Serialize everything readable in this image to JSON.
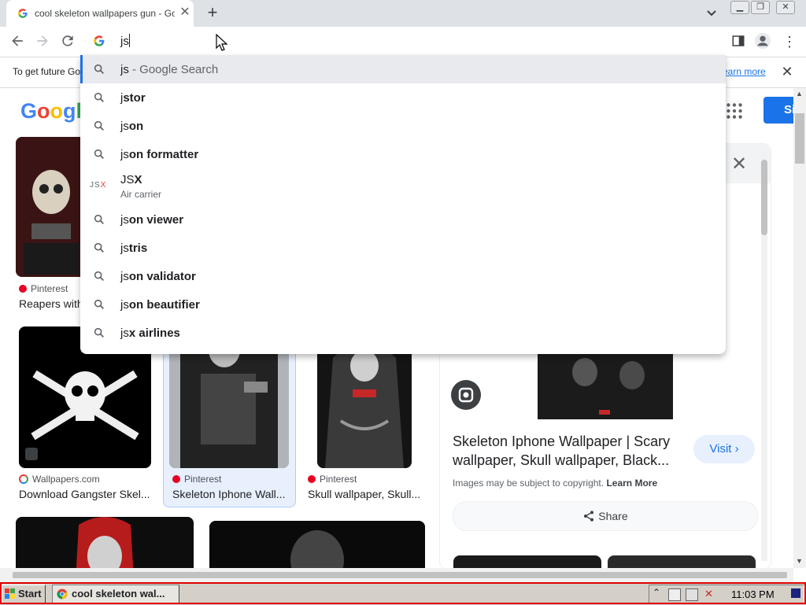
{
  "browser": {
    "tab_title": "cool skeleton wallpapers gun - Goog",
    "tab_favicon": "google-g-icon",
    "omnibox_value": "js",
    "info_bar_text": "To get future Go",
    "info_bar_link": "earn more"
  },
  "dropdown": {
    "suggestions": [
      {
        "prefix": "js",
        "rest": " - Google Search",
        "icon": "search-icon",
        "selected": true
      },
      {
        "prefix": "j",
        "rest": "stor",
        "icon": "search-icon"
      },
      {
        "prefix": "js",
        "rest": "on",
        "icon": "search-icon"
      },
      {
        "prefix": "js",
        "rest": "on formatter",
        "icon": "search-icon"
      },
      {
        "prefix": "JS",
        "rest": "X",
        "sub": "Air carrier",
        "icon": "jsx-logo"
      },
      {
        "prefix": "js",
        "rest": "on viewer",
        "icon": "search-icon"
      },
      {
        "prefix": "js",
        "rest": "tris",
        "icon": "search-icon"
      },
      {
        "prefix": "js",
        "rest": "on validator",
        "icon": "search-icon"
      },
      {
        "prefix": "js",
        "rest": "on beautifier",
        "icon": "search-icon"
      },
      {
        "prefix": "js",
        "rest": "x airlines",
        "icon": "search-icon"
      }
    ]
  },
  "page": {
    "logo": "Google",
    "signin_label": "Si",
    "results": [
      {
        "source": "Pinterest",
        "caption": "Reapers with"
      },
      {
        "source": "Wallpapers.com",
        "caption": "Download Gangster Skel..."
      },
      {
        "source": "Pinterest",
        "caption": "Skeleton Iphone Wall..."
      },
      {
        "source": "Pinterest",
        "caption": "Skull wallpaper, Skull..."
      }
    ],
    "panel": {
      "title": "Skeleton Iphone Wallpaper | Scary wallpaper, Skull wallpaper, Black...",
      "visit_label": "Visit",
      "copyright_text": "Images may be subject to copyright.",
      "copyright_link": "Learn More",
      "share_label": "Share"
    }
  },
  "taskbar": {
    "start_label": "Start",
    "task_label": "cool skeleton wal...",
    "clock": "11:03 PM"
  },
  "colors": {
    "accent": "#1a73e8",
    "taskbar_outline": "#e00000"
  }
}
